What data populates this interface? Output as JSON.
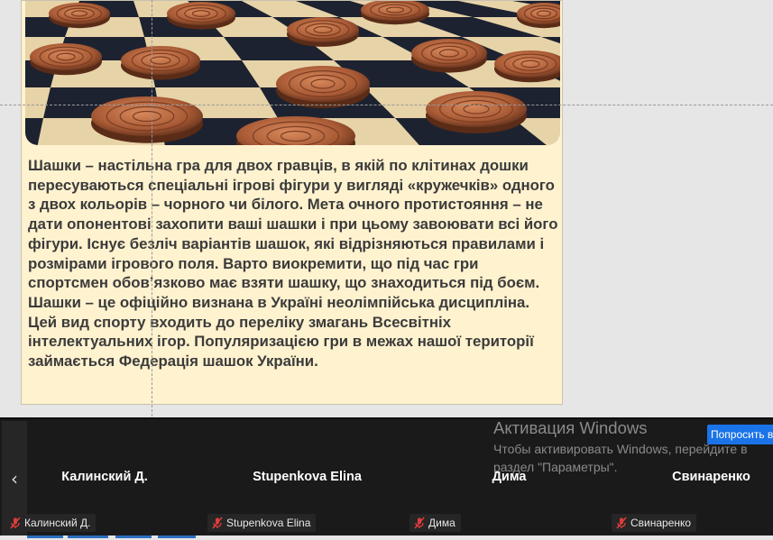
{
  "slide": {
    "paragraphs": [
      "Шашки – настільна гра для двох гравців, в якій по клітинах дошки пересуваються спеціальні ігрові фігури у вигляді «кружечків» одного з двох кольорів – чорного чи білого. Мета очного протистояння – не дати опонентові захопити ваші шашки і при цьому завоювати всі його фігури. Існує безліч варіантів шашок, які відрізняються правилами і розмірами ігрового поля. Варто виокремити, що під час гри спортсмен обов’язково має взяти шашку, що знаходиться під боєм.",
      "Шашки – це офіційно визнана в Україні неолімпійська дисципліна. Цей вид спорту входить до переліку змагань Всесвітніх інтелектуальних ігор. Популяризацією гри в межах нашої території займається Федерація шашок України."
    ],
    "image_icon": "checkers-board-image"
  },
  "participants": [
    {
      "name": "Калинский Д.",
      "label": "Калинский Д."
    },
    {
      "name": "Stupenkova Elina",
      "label": "Stupenkova Elina"
    },
    {
      "name": "Дима",
      "label": "Дима"
    },
    {
      "name": "Свинаренко",
      "label": "Свинаренко"
    }
  ],
  "nav": {
    "prev_icon": "chevron-left-icon",
    "prev_glyph": "‹"
  },
  "windows_activation": {
    "title": "Активация Windows",
    "text": "Чтобы активировать Windows, перейдите в раздел \"Параметры\".",
    "button": "Попросить в"
  },
  "colors": {
    "slide_bg": "#fff2cf",
    "strip_bg": "#1a1a1a",
    "muted_mic": "#e03c3c",
    "button_blue": "#1a73e8"
  }
}
